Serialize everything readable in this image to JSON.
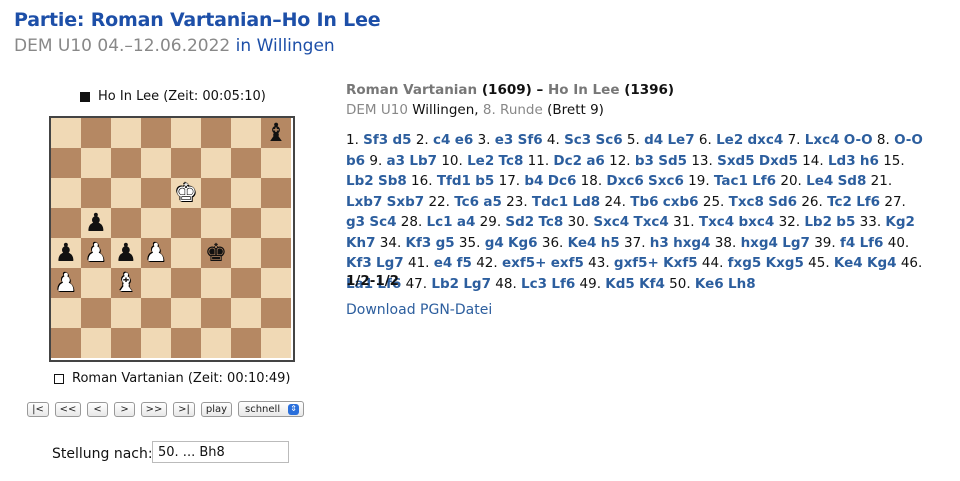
{
  "header": {
    "title": "Partie: Roman Vartanian–Ho In Lee",
    "subtitle_event": "DEM U10 04.–12.06.2022",
    "subtitle_link": "in Willingen"
  },
  "board": {
    "top_player": "Ho In Lee (Zeit: 00:05:10)",
    "bottom_player": "Roman Vartanian (Zeit: 00:10:49)",
    "position": [
      [
        "",
        "",
        "",
        "",
        "",
        "",
        "",
        "bB"
      ],
      [
        "",
        "",
        "",
        "",
        "",
        "",
        "",
        ""
      ],
      [
        "",
        "",
        "",
        "",
        "wK",
        "",
        "",
        ""
      ],
      [
        "",
        "bP",
        "",
        "",
        "",
        "",
        "",
        ""
      ],
      [
        "bP",
        "wP",
        "bP",
        "wP",
        "",
        "bK",
        "",
        ""
      ],
      [
        "wP",
        "",
        "wB",
        "",
        "",
        "",
        "",
        ""
      ],
      [
        "",
        "",
        "",
        "",
        "",
        "",
        "",
        ""
      ],
      [
        "",
        "",
        "",
        "",
        "",
        "",
        "",
        ""
      ]
    ]
  },
  "controls": {
    "first": "|<",
    "back_far": "<<",
    "back": "<",
    "forward": ">",
    "forward_far": ">>",
    "last": ">|",
    "play": "play",
    "speed_selected": "schnell"
  },
  "position_after": {
    "label": "Stellung nach:",
    "value": "50. ... Bh8"
  },
  "game": {
    "white_name": "Roman Vartanian",
    "white_rating": "(1609)",
    "sep": "–",
    "black_name": "Ho In Lee",
    "black_rating": "(1396)",
    "event": "DEM U10",
    "site": "Willingen,",
    "round": "8. Runde",
    "board_no": "(Brett 9)",
    "result": "1/2-1/2",
    "download": "Download PGN-Datei",
    "moves": [
      [
        "1.",
        "Sf3",
        "d5"
      ],
      [
        "2.",
        "c4",
        "e6"
      ],
      [
        "3.",
        "e3",
        "Sf6"
      ],
      [
        "4.",
        "Sc3",
        "Sc6"
      ],
      [
        "5.",
        "d4",
        "Le7"
      ],
      [
        "6.",
        "Le2",
        "dxc4"
      ],
      [
        "7.",
        "Lxc4",
        "O-O"
      ],
      [
        "8.",
        "O-O",
        "b6"
      ],
      [
        "9.",
        "a3",
        "Lb7"
      ],
      [
        "10.",
        "Le2",
        "Tc8"
      ],
      [
        "11.",
        "Dc2",
        "a6"
      ],
      [
        "12.",
        "b3",
        "Sd5"
      ],
      [
        "13.",
        "Sxd5",
        "Dxd5"
      ],
      [
        "14.",
        "Ld3",
        "h6"
      ],
      [
        "15.",
        "Lb2",
        "Sb8"
      ],
      [
        "16.",
        "Tfd1",
        "b5"
      ],
      [
        "17.",
        "b4",
        "Dc6"
      ],
      [
        "18.",
        "Dxc6",
        "Sxc6"
      ],
      [
        "19.",
        "Tac1",
        "Lf6"
      ],
      [
        "20.",
        "Le4",
        "Sd8"
      ],
      [
        "21.",
        "Lxb7",
        "Sxb7"
      ],
      [
        "22.",
        "Tc6",
        "a5"
      ],
      [
        "23.",
        "Tdc1",
        "Ld8"
      ],
      [
        "24.",
        "Tb6",
        "cxb6"
      ],
      [
        "25.",
        "Txc8",
        "Sd6"
      ],
      [
        "26.",
        "Tc2",
        "Lf6"
      ],
      [
        "27.",
        "g3",
        "Sc4"
      ],
      [
        "28.",
        "Lc1",
        "a4"
      ],
      [
        "29.",
        "Sd2",
        "Tc8"
      ],
      [
        "30.",
        "Sxc4",
        "Txc4"
      ],
      [
        "31.",
        "Txc4",
        "bxc4"
      ],
      [
        "32.",
        "Lb2",
        "b5"
      ],
      [
        "33.",
        "Kg2",
        "Kh7"
      ],
      [
        "34.",
        "Kf3",
        "g5"
      ],
      [
        "35.",
        "g4",
        "Kg6"
      ],
      [
        "36.",
        "Ke4",
        "h5"
      ],
      [
        "37.",
        "h3",
        "hxg4"
      ],
      [
        "38.",
        "hxg4",
        "Lg7"
      ],
      [
        "39.",
        "f4",
        "Lf6"
      ],
      [
        "40.",
        "Kf3",
        "Lg7"
      ],
      [
        "41.",
        "e4",
        "f5"
      ],
      [
        "42.",
        "exf5+",
        "exf5"
      ],
      [
        "43.",
        "gxf5+",
        "Kxf5"
      ],
      [
        "44.",
        "fxg5",
        "Kxg5"
      ],
      [
        "45.",
        "Ke4",
        "Kg4"
      ],
      [
        "46.",
        "La1",
        "Lf6"
      ],
      [
        "47.",
        "Lb2",
        "Lg7"
      ],
      [
        "48.",
        "Lc3",
        "Lf6"
      ],
      [
        "49.",
        "Kd5",
        "Kf4"
      ],
      [
        "50.",
        "Ke6",
        "Lh8"
      ]
    ]
  }
}
